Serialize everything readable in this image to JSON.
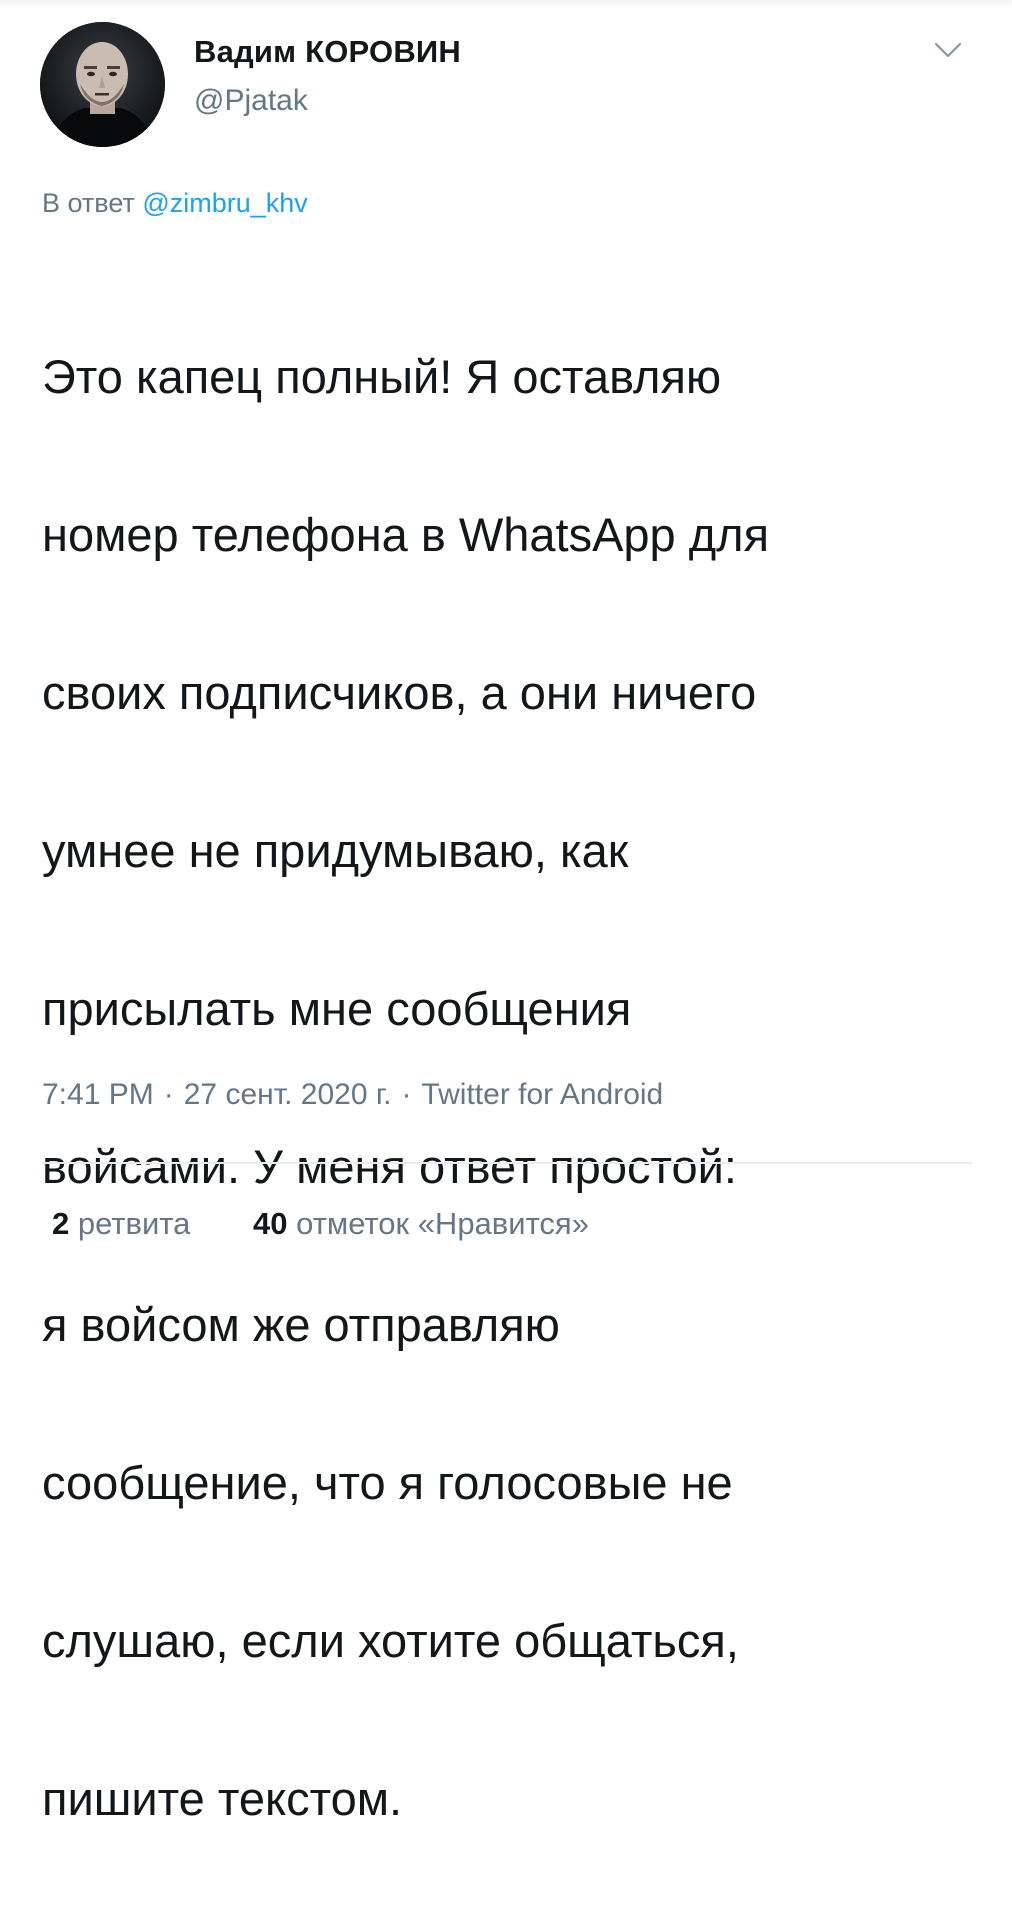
{
  "tweet": {
    "author": {
      "name": "Вадим КОРОВИН",
      "handle": "@Pjatak"
    },
    "reply": {
      "prefix": "В ответ",
      "handle": "@zimbru_khv"
    },
    "text_lines": [
      "Это капец полный! Я оставляю",
      "номер телефона в WhatsApp для",
      "своих подписчиков, а они ничего",
      "умнее не придумываю, как",
      "присылать мне сообщения",
      "войсами. У меня ответ простой:",
      "я войсом же отправляю",
      "сообщение, что я голосовые не",
      "слушаю, если хотите общаться,",
      "пишите текстом."
    ],
    "meta": {
      "time": "7:41 PM",
      "separator": "·",
      "date": "27 сент. 2020 г.",
      "source": "Twitter for Android"
    },
    "stats": {
      "retweets_count": "2",
      "retweets_label": "ретвита",
      "likes_count": "40",
      "likes_label": "отметок «Нравится»"
    }
  },
  "icons": {
    "menu": "chevron-down-icon"
  },
  "colors": {
    "text": "#14171a",
    "secondary": "#657786",
    "link": "#1da1f2",
    "divider": "#e6ecf0"
  }
}
